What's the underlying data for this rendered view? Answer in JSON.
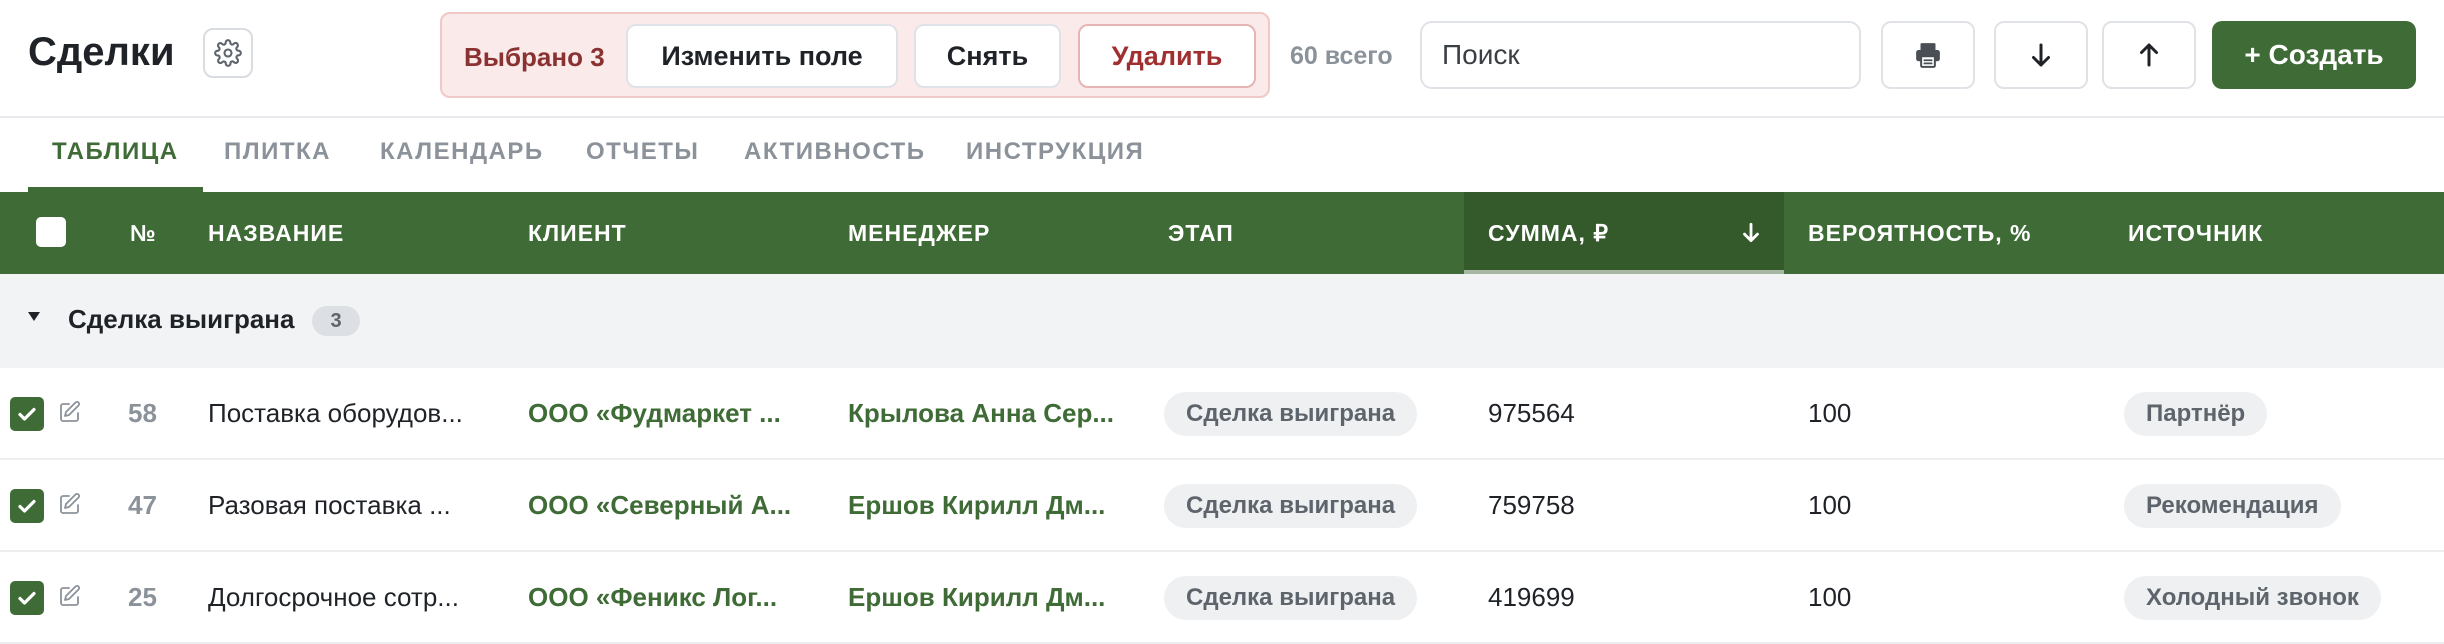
{
  "header": {
    "title": "Сделки",
    "selection": {
      "count_label": "Выбрано 3",
      "change_field_label": "Изменить поле",
      "clear_label": "Снять",
      "delete_label": "Удалить"
    },
    "total_label": "60 всего",
    "search_placeholder": "Поиск",
    "create_label": "+ Создать"
  },
  "tabs": [
    {
      "label": "ТАБЛИЦА",
      "active": true
    },
    {
      "label": "ПЛИТКА",
      "active": false
    },
    {
      "label": "КАЛЕНДАРЬ",
      "active": false
    },
    {
      "label": "ОТЧЕТЫ",
      "active": false
    },
    {
      "label": "АКТИВНОСТЬ",
      "active": false
    },
    {
      "label": "ИНСТРУКЦИЯ",
      "active": false
    }
  ],
  "table": {
    "columns": {
      "num": "№",
      "name": "НАЗВАНИЕ",
      "client": "КЛИЕНТ",
      "manager": "МЕНЕДЖЕР",
      "stage": "ЭТАП",
      "sum": "СУММА, ₽",
      "probability": "ВЕРОЯТНОСТЬ, %",
      "source": "ИСТОЧНИК"
    },
    "sorted_column": "sum",
    "sort_direction": "descending",
    "group": {
      "title": "Сделка выиграна",
      "count": "3"
    },
    "rows": [
      {
        "selected": true,
        "num": "58",
        "name": "Поставка оборудов...",
        "client": "ООО «Фудмаркет ...",
        "manager": "Крылова Анна Сер...",
        "stage": "Сделка выиграна",
        "sum": "975564",
        "probability": "100",
        "source": "Партнёр"
      },
      {
        "selected": true,
        "num": "47",
        "name": "Разовая поставка ...",
        "client": "ООО «Северный А...",
        "manager": "Ершов Кирилл Дм...",
        "stage": "Сделка выиграна",
        "sum": "759758",
        "probability": "100",
        "source": "Рекомендация"
      },
      {
        "selected": true,
        "num": "25",
        "name": "Долгосрочное сотр...",
        "client": "ООО «Феникс Лог...",
        "manager": "Ершов Кирилл Дм...",
        "stage": "Сделка выиграна",
        "sum": "419699",
        "probability": "100",
        "source": "Холодный звонок"
      }
    ]
  },
  "colors": {
    "accent": "#3f6b36",
    "accent_dark": "#345a2c",
    "danger": "#a03030",
    "selection_bg": "#fbeaea",
    "muted": "#8b929a"
  },
  "icons": {
    "settings": "gear-icon",
    "print": "printer-icon",
    "sort_desc": "arrow-down-icon",
    "sort_asc": "arrow-up-icon",
    "edit": "pencil-icon",
    "group_toggle": "caret-down-icon",
    "checkbox": "checkmark-icon"
  }
}
